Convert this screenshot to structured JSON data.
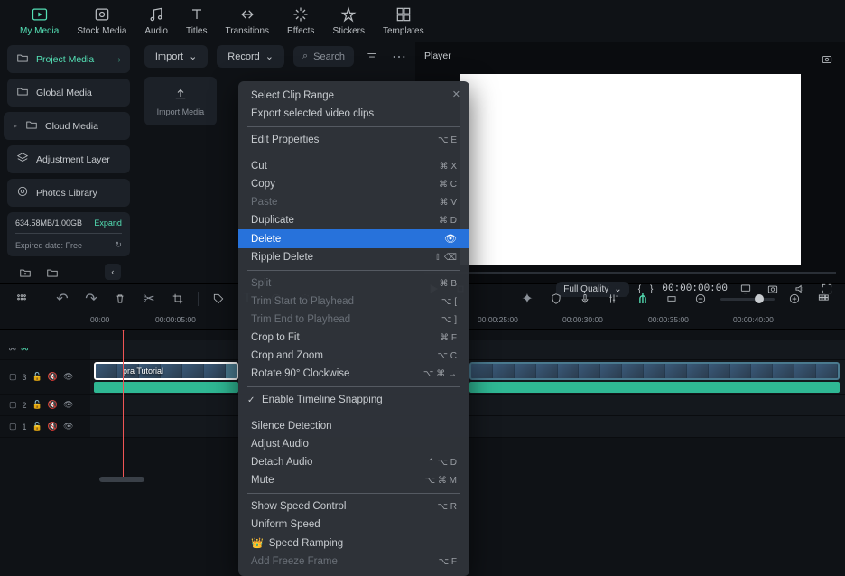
{
  "topTabs": [
    {
      "id": "my-media",
      "label": "My Media",
      "active": true
    },
    {
      "id": "stock-media",
      "label": "Stock Media"
    },
    {
      "id": "audio",
      "label": "Audio"
    },
    {
      "id": "titles",
      "label": "Titles"
    },
    {
      "id": "transitions",
      "label": "Transitions"
    },
    {
      "id": "effects",
      "label": "Effects"
    },
    {
      "id": "stickers",
      "label": "Stickers"
    },
    {
      "id": "templates",
      "label": "Templates"
    }
  ],
  "importBar": {
    "import": "Import",
    "record": "Record",
    "searchPlaceholder": "Search"
  },
  "tree": [
    {
      "id": "project-media",
      "label": "Project Media",
      "active": true,
      "chev": true
    },
    {
      "id": "global-media",
      "label": "Global Media"
    },
    {
      "id": "cloud-media",
      "label": "Cloud Media",
      "caret": true
    },
    {
      "id": "adjustment-layer",
      "label": "Adjustment Layer"
    },
    {
      "id": "photos-library",
      "label": "Photos Library"
    }
  ],
  "storage": {
    "usage": "634.58MB/1.00GB",
    "expand": "Expand",
    "expired": "Expired date: Free"
  },
  "importTile": {
    "label": "Import Media"
  },
  "player": {
    "title": "Player",
    "timecode": "00:00:00:00",
    "quality": "Full Quality",
    "brackets": {
      "l": "{",
      "r": "}"
    }
  },
  "ruler": [
    "00:00",
    "00:00:05:00",
    "00:00:25:00",
    "00:00:30:00",
    "00:00:35:00",
    "00:00:40:00"
  ],
  "tracks": {
    "t3": "3",
    "t2": "2",
    "t1": "1"
  },
  "clip": {
    "label": "pra Tutorial"
  },
  "contextMenu": {
    "items": [
      {
        "label": "Select Clip Range"
      },
      {
        "label": "Export selected video clips"
      },
      {
        "sep": true
      },
      {
        "label": "Edit Properties",
        "shortcut": "⌥ E"
      },
      {
        "sep": true
      },
      {
        "label": "Cut",
        "shortcut": "⌘ X"
      },
      {
        "label": "Copy",
        "shortcut": "⌘ C"
      },
      {
        "label": "Paste",
        "shortcut": "⌘ V",
        "disabled": true
      },
      {
        "label": "Duplicate",
        "shortcut": "⌘ D"
      },
      {
        "label": "Delete",
        "shortcut": "",
        "selected": true,
        "eye": true
      },
      {
        "label": "Ripple Delete",
        "shortcut": "⇧ ⌫"
      },
      {
        "sep": true
      },
      {
        "label": "Split",
        "shortcut": "⌘ B",
        "disabled": true
      },
      {
        "label": "Trim Start to Playhead",
        "shortcut": "⌥ [",
        "disabled": true
      },
      {
        "label": "Trim End to Playhead",
        "shortcut": "⌥ ]",
        "disabled": true
      },
      {
        "label": "Crop to Fit",
        "shortcut": "⌘ F"
      },
      {
        "label": "Crop and Zoom",
        "shortcut": "⌥ C"
      },
      {
        "label": "Rotate 90° Clockwise",
        "shortcut": "⌥ ⌘ →"
      },
      {
        "sep": true
      },
      {
        "label": "Enable Timeline Snapping",
        "check": true
      },
      {
        "sep": true
      },
      {
        "label": "Silence Detection"
      },
      {
        "label": "Adjust Audio"
      },
      {
        "label": "Detach Audio",
        "shortcut": "⌃ ⌥ D"
      },
      {
        "label": "Mute",
        "shortcut": "⌥ ⌘ M"
      },
      {
        "sep": true
      },
      {
        "label": "Show Speed Control",
        "shortcut": "⌥ R"
      },
      {
        "label": "Uniform Speed"
      },
      {
        "label": "Speed Ramping",
        "icon": "👑"
      },
      {
        "label": "Add Freeze Frame",
        "shortcut": "⌥ F",
        "disabled": true
      }
    ]
  }
}
